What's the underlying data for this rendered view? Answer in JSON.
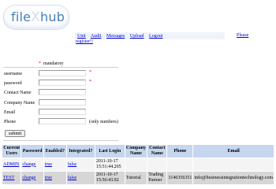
{
  "logo": {
    "part1": "file",
    "part2": "X",
    "part3": "hub"
  },
  "nav": {
    "items": [
      "Unit",
      "Audit",
      "Messages",
      "Upload",
      "Logout"
    ],
    "register": "register!!",
    "please": "Please"
  },
  "form": {
    "mandatory_star": "*",
    "mandatory_text": "mandatory",
    "fields": [
      {
        "label": "username",
        "value": "",
        "required": "*"
      },
      {
        "label": "password",
        "value": "",
        "required": "*"
      },
      {
        "label": "Contact Name",
        "value": "",
        "required": ""
      },
      {
        "label": "Company Name",
        "value": "",
        "required": ""
      },
      {
        "label": "Email",
        "value": "",
        "required": ""
      },
      {
        "label": "Phone",
        "value": "",
        "required": "",
        "note": "(only numbers)"
      }
    ],
    "submit_label": "submit"
  },
  "users_table": {
    "headers": [
      "Current Users",
      "Password",
      "Enabled?",
      "Integrated?",
      "Last Login",
      "Company Name",
      "Contact Name",
      "Phone",
      "Email"
    ],
    "rows": [
      {
        "user": "ADMIN",
        "password": "change",
        "enabled": "true",
        "integrated": "false",
        "last_login": "2011-10-17 15:51:44.205",
        "company": "",
        "contact": "",
        "phone": "",
        "email": ""
      },
      {
        "user": "TEST",
        "password": "change",
        "enabled": "true",
        "integrated": "false",
        "last_login": "2011-10-17 15:56:43.92",
        "company": "Tutorial",
        "contact": "Trading Partner",
        "phone": "3146356351",
        "email": "info@businessintegrationtechnology.com"
      }
    ]
  },
  "colors": {
    "link": "#0000d0",
    "required_star": "#e00000",
    "header_bg": "#c5d6ee",
    "row1_bg": "#f4f4f4",
    "row2_bg": "#d6d6d6",
    "logo_blue": "#4a80b4"
  }
}
